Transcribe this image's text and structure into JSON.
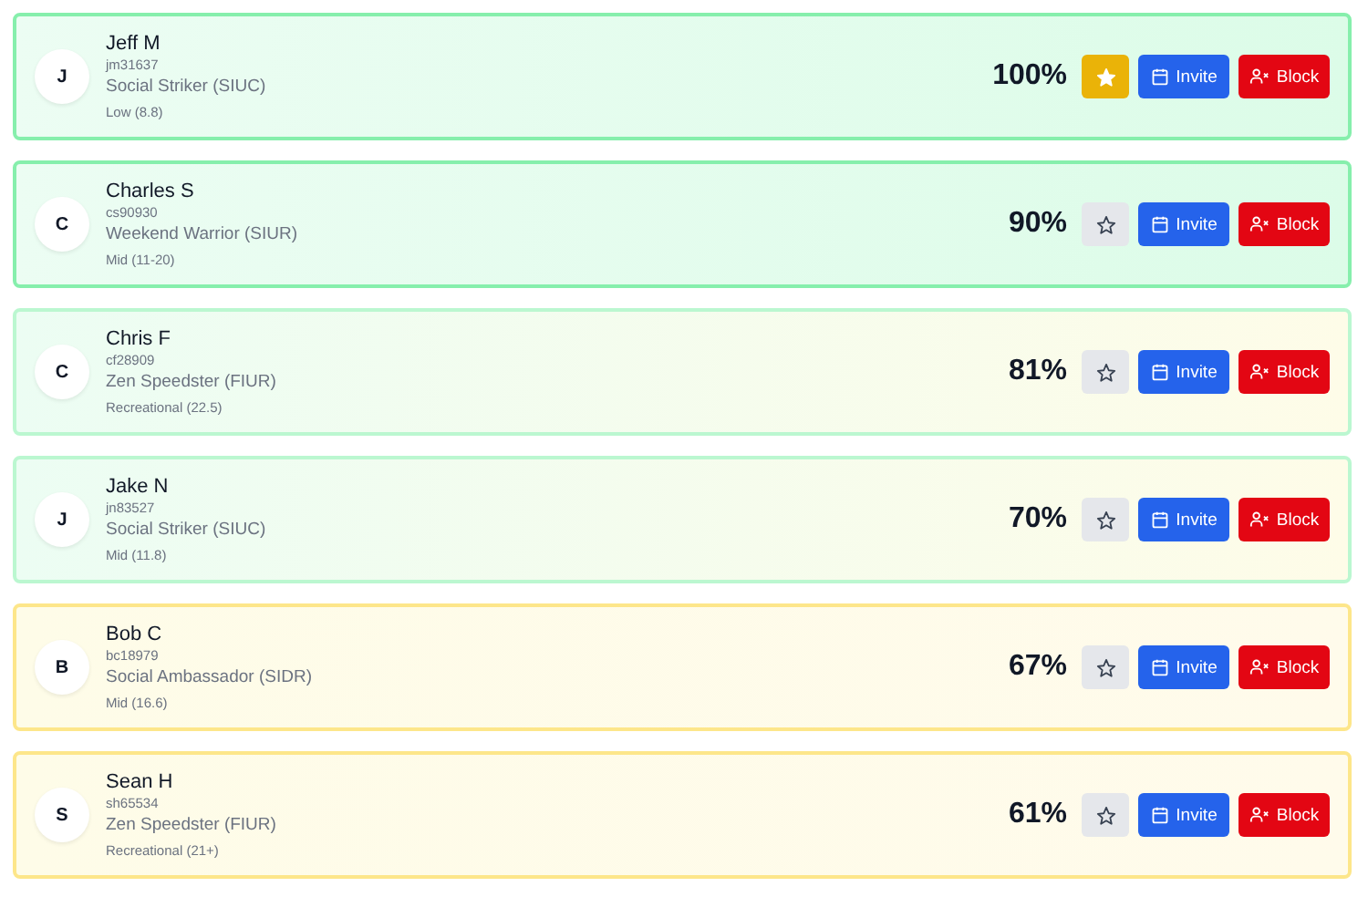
{
  "players": [
    {
      "initial": "J",
      "name": "Jeff M",
      "id": "jm31637",
      "style": "Social Striker (SIUC)",
      "level": "Low (8.8)",
      "match": "100%",
      "kind": "high",
      "starred": true,
      "invite": "Invite",
      "block": "Block"
    },
    {
      "initial": "C",
      "name": "Charles S",
      "id": "cs90930",
      "style": "Weekend Warrior (SIUR)",
      "level": "Mid (11-20)",
      "match": "90%",
      "kind": "high",
      "starred": false,
      "invite": "Invite",
      "block": "Block"
    },
    {
      "initial": "C",
      "name": "Chris F",
      "id": "cf28909",
      "style": "Zen Speedster (FIUR)",
      "level": "Recreational (22.5)",
      "match": "81%",
      "kind": "mid",
      "starred": false,
      "invite": "Invite",
      "block": "Block"
    },
    {
      "initial": "J",
      "name": "Jake N",
      "id": "jn83527",
      "style": "Social Striker (SIUC)",
      "level": "Mid (11.8)",
      "match": "70%",
      "kind": "mid",
      "starred": false,
      "invite": "Invite",
      "block": "Block"
    },
    {
      "initial": "B",
      "name": "Bob C",
      "id": "bc18979",
      "style": "Social Ambassador (SIDR)",
      "level": "Mid (16.6)",
      "match": "67%",
      "kind": "low",
      "starred": false,
      "invite": "Invite",
      "block": "Block"
    },
    {
      "initial": "S",
      "name": "Sean H",
      "id": "sh65534",
      "style": "Zen Speedster (FIUR)",
      "level": "Recreational (21+)",
      "match": "61%",
      "kind": "low",
      "starred": false,
      "invite": "Invite",
      "block": "Block"
    }
  ]
}
